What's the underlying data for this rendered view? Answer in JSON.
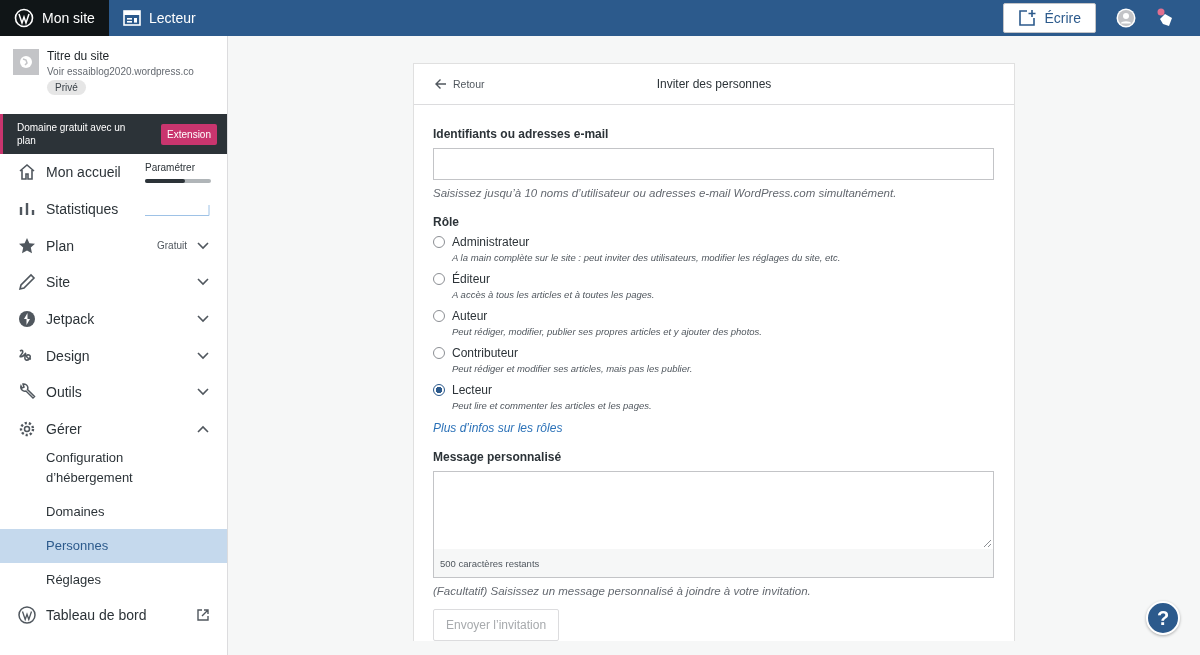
{
  "topbar": {
    "tabs": [
      {
        "label": "Mon site",
        "selected": true
      },
      {
        "label": "Lecteur",
        "selected": false
      }
    ],
    "write_button": "Écrire"
  },
  "sidebar": {
    "site": {
      "title": "Titre du site",
      "url": "Voir essaiblog2020.wordpress.co",
      "badge": "Privé"
    },
    "banner": {
      "text": "Domaine gratuit avec un plan",
      "button": "Extension"
    },
    "items": [
      {
        "kind": "progress",
        "label": "Mon accueil",
        "note": "Paramétrer",
        "level": 0.6
      },
      {
        "kind": "sparkline",
        "label": "Statistiques"
      },
      {
        "kind": "menu",
        "label": "Plan",
        "note": "Gratuit",
        "expanded": false
      },
      {
        "kind": "menu",
        "label": "Site",
        "expanded": false
      },
      {
        "kind": "menu",
        "label": "Jetpack",
        "expanded": false
      },
      {
        "kind": "menu",
        "label": "Design",
        "expanded": false
      },
      {
        "kind": "menu",
        "label": "Outils",
        "expanded": false
      },
      {
        "kind": "menu",
        "label": "Gérer",
        "expanded": true,
        "children": [
          {
            "label": "Configuration d’hébergement",
            "selected": false
          },
          {
            "label": "Domaines",
            "selected": false
          },
          {
            "label": "Personnes",
            "selected": true
          },
          {
            "label": "Réglages",
            "selected": false
          }
        ]
      },
      {
        "kind": "external",
        "label": "Tableau de bord"
      }
    ]
  },
  "card": {
    "back": "Retour",
    "title": "Inviter des personnes",
    "users_label": "Identifiants ou adresses e-mail",
    "users_hint": "Saisissez jusqu’à 10 noms d’utilisateur ou adresses e-mail WordPress.com simultanément.",
    "role_label": "Rôle",
    "roles": [
      {
        "label": "Administrateur",
        "description": "A la main complète sur le site : peut inviter des utilisateurs, modifier les réglages du site, etc.",
        "selected": false
      },
      {
        "label": "Éditeur",
        "description": "A accès à tous les articles et à toutes les pages.",
        "selected": false
      },
      {
        "label": "Auteur",
        "description": "Peut rédiger, modifier, publier ses propres articles et y ajouter des photos.",
        "selected": false
      },
      {
        "label": "Contributeur",
        "description": "Peut rédiger et modifier ses articles, mais pas les publier.",
        "selected": false
      },
      {
        "label": "Lecteur",
        "description": "Peut lire et commenter les articles et les pages.",
        "selected": true
      }
    ],
    "roles_link": "Plus d’infos sur les rôles",
    "message_label": "Message personnalisé",
    "message_counter": "500 caractères restants",
    "message_hint": "(Facultatif) Saisissez un message personnalisé à joindre à votre invitation.",
    "send_button": {
      "label": "Envoyer l’invitation",
      "disabled": true
    }
  },
  "help_button": "?"
}
